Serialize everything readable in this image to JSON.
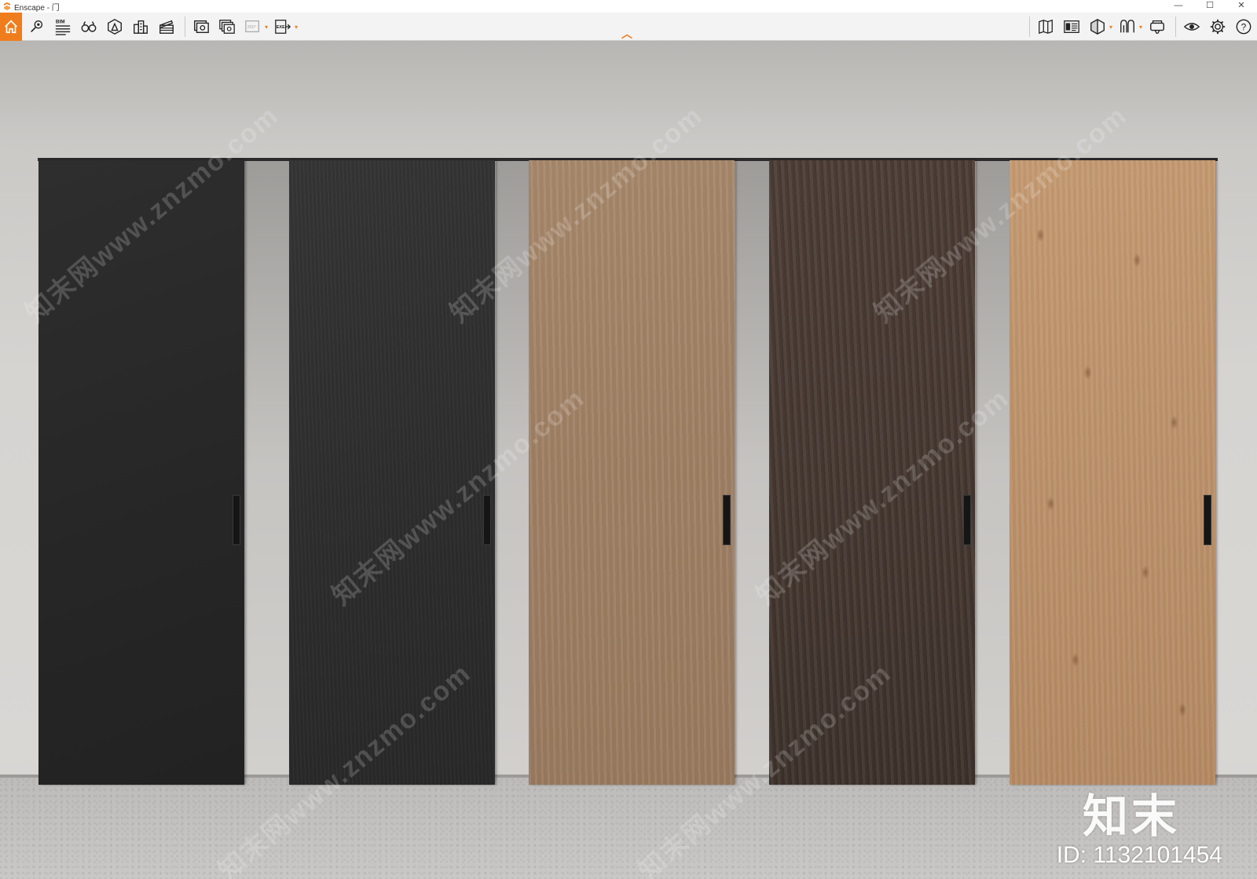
{
  "window": {
    "title": "Enscape - 门",
    "controls": {
      "minimize": "—",
      "maximize": "☐",
      "close": "✕"
    }
  },
  "toolbar": {
    "accent_color": "#f07d1c",
    "left_tools": [
      {
        "name": "home-icon",
        "label": ""
      },
      {
        "name": "pin-icon",
        "label": ""
      },
      {
        "name": "bim-icon",
        "label": "BIM"
      },
      {
        "name": "binoculars-icon",
        "label": ""
      },
      {
        "name": "asset-library-icon",
        "label": ""
      },
      {
        "name": "buildings-icon",
        "label": ""
      },
      {
        "name": "clapperboard-icon",
        "label": ""
      },
      {
        "name": "screenshot-icon",
        "label": ""
      },
      {
        "name": "batch-render-icon",
        "label": ""
      },
      {
        "name": "panorama-icon",
        "label": "360°"
      },
      {
        "name": "export-exe-icon",
        "label": "EXE"
      }
    ],
    "right_tools": [
      {
        "name": "map-icon"
      },
      {
        "name": "material-editor-icon"
      },
      {
        "name": "cube-view-icon"
      },
      {
        "name": "visual-settings-icon"
      },
      {
        "name": "vr-headset-icon"
      },
      {
        "name": "eye-icon"
      },
      {
        "name": "settings-icon"
      },
      {
        "name": "help-icon"
      }
    ]
  },
  "viewport": {
    "doors": [
      {
        "name": "door-black-matte"
      },
      {
        "name": "door-black-wood"
      },
      {
        "name": "door-light-oak"
      },
      {
        "name": "door-dark-walnut"
      },
      {
        "name": "door-knotty-pine"
      }
    ],
    "watermark_text": "知末网www.znzmo.com",
    "brand_logo_text": "知末",
    "id_text": "ID: 1132101454"
  }
}
